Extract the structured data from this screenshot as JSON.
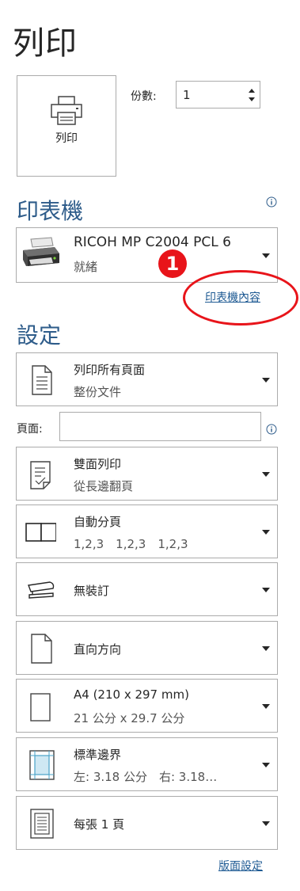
{
  "title": "列印",
  "print_button": {
    "label": "列印",
    "icon": "printer-icon"
  },
  "copies": {
    "label": "份數:",
    "value": "1"
  },
  "printer_section": {
    "title": "印表機",
    "printer_name": "RICOH MP C2004 PCL 6",
    "printer_status": "就緒",
    "properties_link": "印表機內容",
    "callout_number": "1"
  },
  "settings_section": {
    "title": "設定",
    "print_range": {
      "line1": "列印所有頁面",
      "line2": "整份文件"
    },
    "pages": {
      "label": "頁面:",
      "value": ""
    },
    "duplex": {
      "line1": "雙面列印",
      "line2": "從長邊翻頁"
    },
    "collate": {
      "line1": "自動分頁",
      "line2": "1,2,3　1,2,3　1,2,3"
    },
    "staple": {
      "line1": "無裝訂"
    },
    "orientation": {
      "line1": "直向方向"
    },
    "paper_size": {
      "line1": "A4 (210 x 297 mm)",
      "line2": "21 公分 x 29.7 公分"
    },
    "margins": {
      "line1": "標準邊界",
      "line2": "左: 3.18 公分　右: 3.18…"
    },
    "pages_per_sheet": {
      "line1": "每張 1 頁"
    },
    "page_setup_link": "版面設定"
  },
  "colors": {
    "accent": "#2e5c8a",
    "link": "#1e5a93",
    "callout": "#e8141a",
    "border": "#ababab"
  }
}
